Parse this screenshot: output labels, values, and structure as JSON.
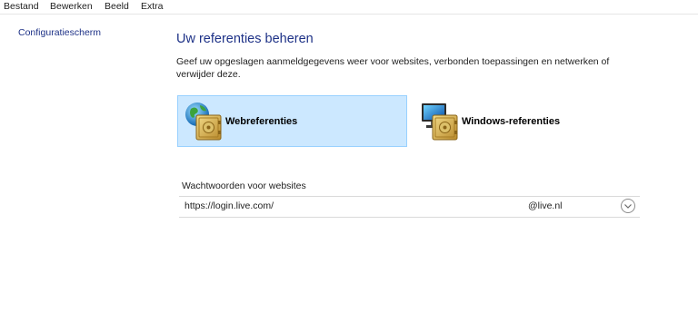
{
  "menu": {
    "items": [
      {
        "label": "Bestand"
      },
      {
        "label": "Bewerken"
      },
      {
        "label": "Beeld"
      },
      {
        "label": "Extra"
      }
    ]
  },
  "sidebar": {
    "home_link": "Configuratiescherm"
  },
  "main": {
    "title": "Uw referenties beheren",
    "description": "Geef uw opgeslagen aanmeldgegevens weer voor websites, verbonden toepassingen en netwerken of verwijder deze.",
    "tiles": [
      {
        "label": "Webreferenties",
        "icon": "globe-vault-icon",
        "selected": true
      },
      {
        "label": "Windows-referenties",
        "icon": "computer-vault-icon",
        "selected": false
      }
    ],
    "section_title": "Wachtwoorden voor websites",
    "credentials": [
      {
        "url": "https://login.live.com/",
        "user": "@live.nl",
        "action_icon": "chevron-down-icon"
      }
    ]
  },
  "colors": {
    "link_blue": "#1e3287",
    "selected_tile_bg": "#cce8ff",
    "selected_tile_border": "#99d1ff",
    "divider": "#d9d9d9"
  }
}
